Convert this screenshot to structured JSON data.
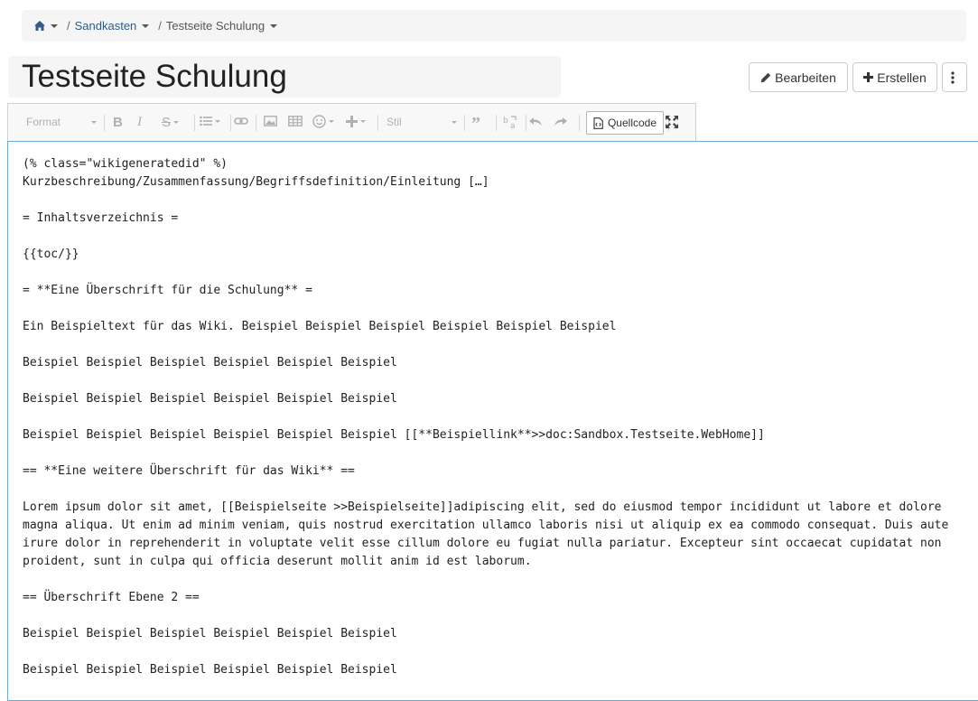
{
  "breadcrumb": {
    "separator": "/",
    "items": [
      "Sandkasten",
      "Testseite Schulung"
    ]
  },
  "page": {
    "title": "Testseite Schulung"
  },
  "actions": {
    "edit_label": "Bearbeiten",
    "create_label": "Erstellen"
  },
  "toolbar": {
    "format_label": "Format",
    "style_label": "Stil",
    "source_label": "Quellcode"
  },
  "editor": {
    "lines": [
      "(% class=\"wikigeneratedid\" %)",
      "Kurzbeschreibung/Zusammenfassung/Begriffsdefinition/Einleitung […]",
      "",
      "= Inhaltsverzeichnis =",
      "",
      "{{toc/}}",
      "",
      "= **Eine Überschrift für die Schulung** =",
      "",
      "Ein Beispieltext für das Wiki. Beispiel Beispiel Beispiel Beispiel Beispiel Beispiel",
      "",
      "Beispiel Beispiel Beispiel Beispiel Beispiel Beispiel",
      "",
      "Beispiel Beispiel Beispiel Beispiel Beispiel Beispiel",
      "",
      "Beispiel Beispiel Beispiel Beispiel Beispiel Beispiel [[**Beispiellink**>>doc:Sandbox.Testseite.WebHome]]",
      "",
      "== **Eine weitere Überschrift für das Wiki** ==",
      "",
      "Lorem ipsum dolor sit amet, [[Beispielseite >>Beispielseite]]adipiscing elit, sed do eiusmod tempor incididunt ut labore et dolore",
      "magna aliqua. Ut enim ad minim veniam, quis nostrud exercitation ullamco laboris nisi ut aliquip ex ea commodo consequat. Duis aute",
      "irure dolor in reprehenderit in voluptate velit esse cillum dolore eu fugiat nulla pariatur. Excepteur sint occaecat cupidatat non",
      "proident, sunt in culpa qui officia deserunt mollit anim id est laborum.",
      "",
      "== Überschrift Ebene 2 ==",
      "",
      "Beispiel Beispiel Beispiel Beispiel Beispiel Beispiel",
      "",
      "Beispiel Beispiel Beispiel Beispiel Beispiel Beispiel"
    ]
  }
}
